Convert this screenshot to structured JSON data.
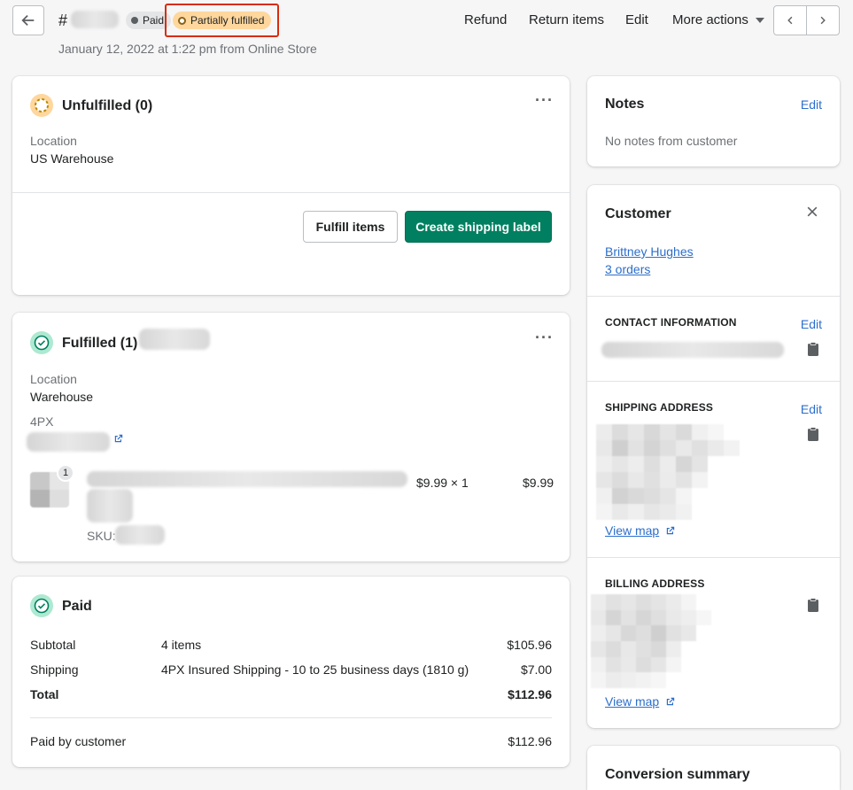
{
  "header": {
    "order_prefix": "#",
    "badge_paid": "Paid",
    "badge_fulfillment": "Partially fulfilled",
    "subtitle": "January 12, 2022 at 1:22 pm from Online Store",
    "actions": {
      "refund": "Refund",
      "return_items": "Return items",
      "edit": "Edit",
      "more_actions": "More actions"
    },
    "icons": {
      "back": "arrow-left-icon",
      "prev": "chevron-left-icon",
      "next": "chevron-right-icon"
    }
  },
  "unfulfilled": {
    "title": "Unfulfilled (0)",
    "location_label": "Location",
    "location_value": "US Warehouse",
    "fulfill_button": "Fulfill items",
    "shipping_label_button": "Create shipping label"
  },
  "fulfilled": {
    "title": "Fulfilled (1)",
    "location_label": "Location",
    "location_value": "Warehouse",
    "carrier": "4PX",
    "item_quantity": "1",
    "item_price_qty": "$9.99 × 1",
    "item_total": "$9.99",
    "sku_label": "SKU:"
  },
  "paid": {
    "title": "Paid",
    "rows": [
      {
        "label": "Subtotal",
        "detail": "4 items",
        "amount": "$105.96"
      },
      {
        "label": "Shipping",
        "detail": "4PX Insured Shipping - 10 to 25 business days (1810 g)",
        "amount": "$7.00"
      },
      {
        "label": "Total",
        "detail": "",
        "amount": "$112.96"
      }
    ],
    "paid_by_label": "Paid by customer",
    "paid_by_amount": "$112.96"
  },
  "notes": {
    "title": "Notes",
    "edit": "Edit",
    "body": "No notes from customer"
  },
  "customer": {
    "title": "Customer",
    "name": "Brittney Hughes",
    "orders": "3 orders",
    "contact_label": "CONTACT INFORMATION",
    "contact_edit": "Edit",
    "shipping_label": "SHIPPING ADDRESS",
    "shipping_edit": "Edit",
    "shipping_map": "View map",
    "billing_label": "BILLING ADDRESS",
    "billing_map": "View map"
  },
  "conversion": {
    "title": "Conversion summary"
  },
  "colors": {
    "primary": "#008060",
    "link": "#2c6ecb",
    "warning_badge": "#ffd79d",
    "highlight": "#d82c0d"
  }
}
